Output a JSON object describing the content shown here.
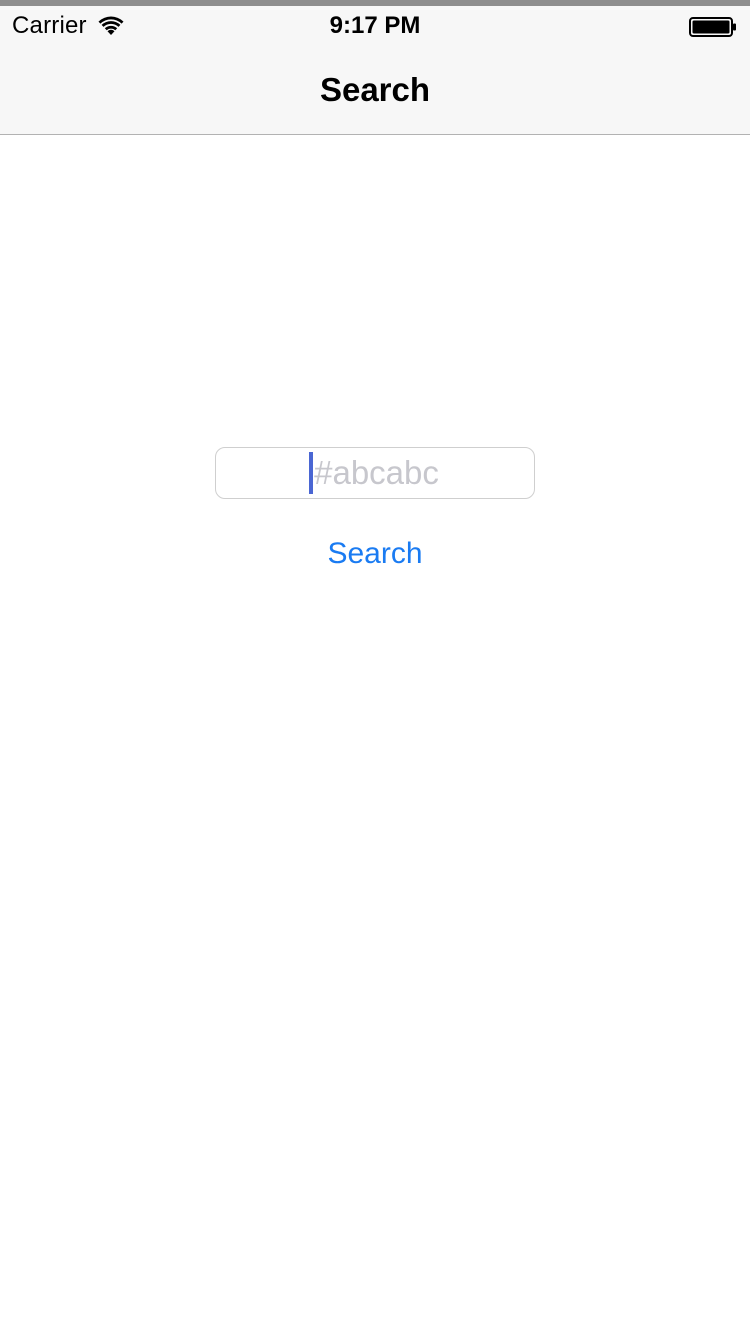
{
  "status_bar": {
    "carrier": "Carrier",
    "time": "9:17 PM",
    "wifi_icon": "wifi-icon",
    "battery_icon": "battery-icon"
  },
  "nav_bar": {
    "title": "Search"
  },
  "search": {
    "placeholder": "#abcabc",
    "value": "",
    "button_label": "Search"
  },
  "colors": {
    "accent": "#1a7bf2",
    "caret": "#4a66d3",
    "placeholder": "#c7c7cd",
    "nav_background": "#f7f7f7"
  }
}
